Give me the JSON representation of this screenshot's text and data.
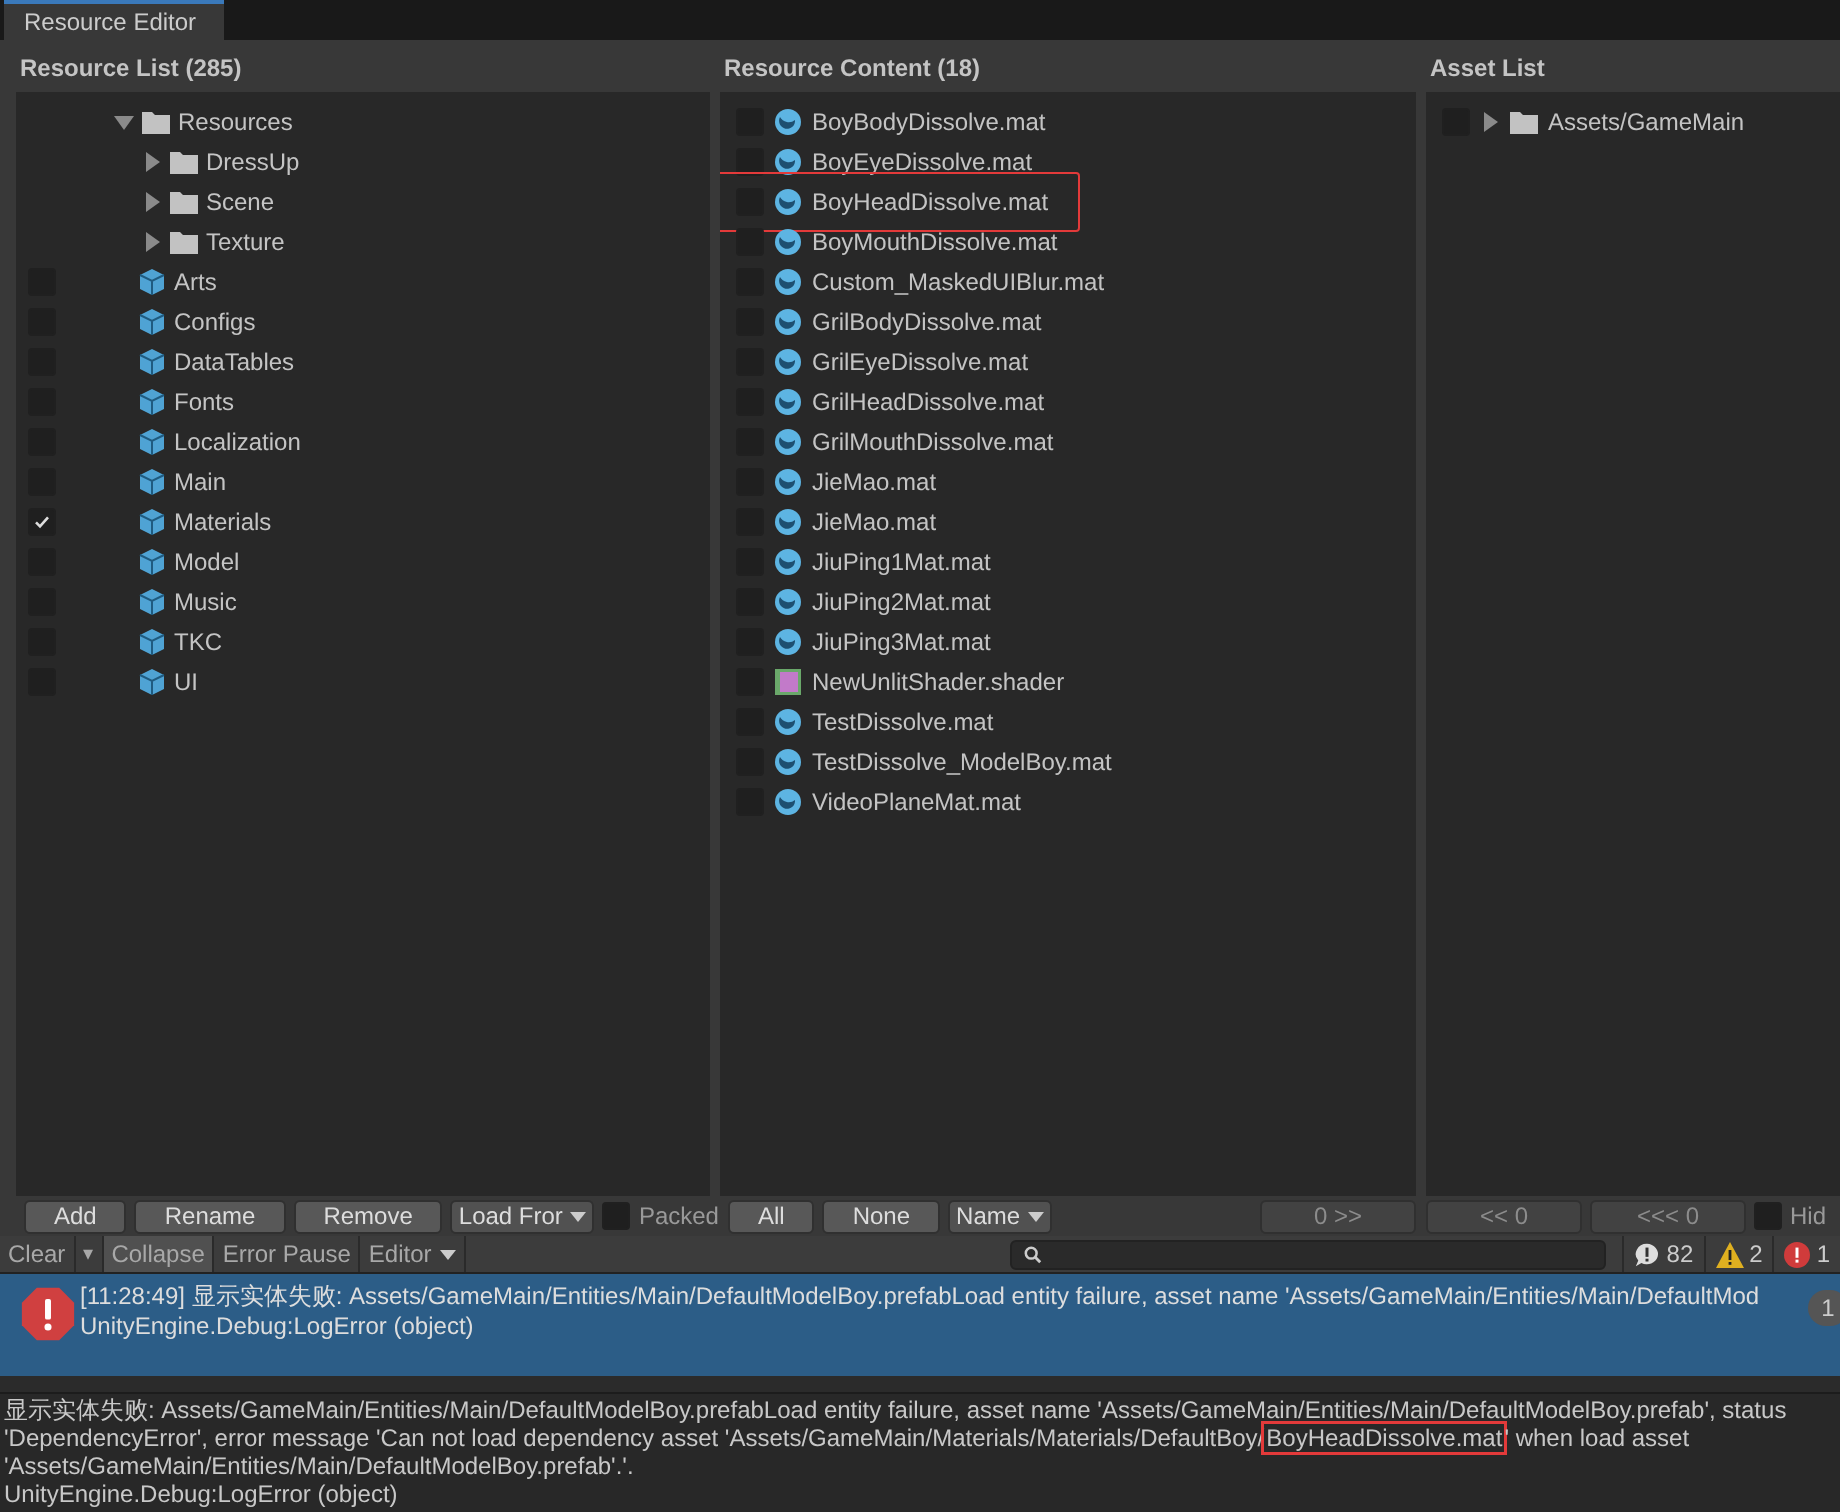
{
  "window": {
    "tab": "Resource Editor"
  },
  "resource_list": {
    "title": "Resource List (285)",
    "tree": [
      {
        "kind": "folder",
        "label": "Resources",
        "expanded": true,
        "children": [
          {
            "kind": "folder",
            "label": "DressUp",
            "expanded": false
          },
          {
            "kind": "folder",
            "label": "Scene",
            "expanded": false
          },
          {
            "kind": "folder",
            "label": "Texture",
            "expanded": false
          },
          {
            "kind": "resource",
            "label": "Arts",
            "checked": false
          },
          {
            "kind": "resource",
            "label": "Configs",
            "checked": false
          },
          {
            "kind": "resource",
            "label": "DataTables",
            "checked": false
          },
          {
            "kind": "resource",
            "label": "Fonts",
            "checked": false
          },
          {
            "kind": "resource",
            "label": "Localization",
            "checked": false
          },
          {
            "kind": "resource",
            "label": "Main",
            "checked": false
          },
          {
            "kind": "resource",
            "label": "Materials",
            "checked": true
          },
          {
            "kind": "resource",
            "label": "Model",
            "checked": false
          },
          {
            "kind": "resource",
            "label": "Music",
            "checked": false
          },
          {
            "kind": "resource",
            "label": "TKC",
            "checked": false
          },
          {
            "kind": "resource",
            "label": "UI",
            "checked": false
          }
        ]
      }
    ],
    "buttons": [
      "Add",
      "Rename",
      "Remove"
    ],
    "load_dropdown": "Load Fror",
    "packed": {
      "label": "Packed",
      "checked": false
    }
  },
  "resource_content": {
    "title": "Resource Content (18)",
    "items": [
      {
        "kind": "material",
        "label": "BoyBodyDissolve.mat",
        "checked": false
      },
      {
        "kind": "material",
        "label": "BoyEyeDissolve.mat",
        "checked": false
      },
      {
        "kind": "material",
        "label": "BoyHeadDissolve.mat",
        "checked": false,
        "highlighted": true
      },
      {
        "kind": "material",
        "label": "BoyMouthDissolve.mat",
        "checked": false
      },
      {
        "kind": "material",
        "label": "Custom_MaskedUIBlur.mat",
        "checked": false
      },
      {
        "kind": "material",
        "label": "GrilBodyDissolve.mat",
        "checked": false
      },
      {
        "kind": "material",
        "label": "GrilEyeDissolve.mat",
        "checked": false
      },
      {
        "kind": "material",
        "label": "GrilHeadDissolve.mat",
        "checked": false
      },
      {
        "kind": "material",
        "label": "GrilMouthDissolve.mat",
        "checked": false
      },
      {
        "kind": "material",
        "label": "JieMao.mat",
        "checked": false
      },
      {
        "kind": "material",
        "label": "JieMao.mat",
        "checked": false
      },
      {
        "kind": "material",
        "label": "JiuPing1Mat.mat",
        "checked": false
      },
      {
        "kind": "material",
        "label": "JiuPing2Mat.mat",
        "checked": false
      },
      {
        "kind": "material",
        "label": "JiuPing3Mat.mat",
        "checked": false
      },
      {
        "kind": "shader",
        "label": "NewUnlitShader.shader",
        "checked": false
      },
      {
        "kind": "material",
        "label": "TestDissolve.mat",
        "checked": false
      },
      {
        "kind": "material",
        "label": "TestDissolve_ModelBoy.mat",
        "checked": false
      },
      {
        "kind": "material",
        "label": "VideoPlaneMat.mat",
        "checked": false
      }
    ],
    "buttons": [
      "All",
      "None"
    ],
    "sort_dropdown": "Name",
    "add_button": "0 >>"
  },
  "asset_list": {
    "title": "Asset List",
    "items": [
      {
        "label": "Assets/GameMain",
        "checked": false,
        "expanded": false
      }
    ],
    "buttons": [
      "<< 0",
      "<<< 0"
    ],
    "hide": {
      "label": "Hid",
      "checked": false
    }
  },
  "console": {
    "toolbar": [
      {
        "kind": "button",
        "label": "Clear",
        "on": false
      },
      {
        "kind": "caret",
        "label": "▾",
        "on": false
      },
      {
        "kind": "button",
        "label": "Collapse",
        "on": true
      },
      {
        "kind": "button",
        "label": "Error Pause",
        "on": false
      },
      {
        "kind": "dropdown",
        "label": "Editor",
        "on": false
      }
    ],
    "counts": [
      {
        "kind": "info",
        "count": "82"
      },
      {
        "kind": "warning",
        "count": "2"
      },
      {
        "kind": "error",
        "count": "1"
      }
    ],
    "entries": [
      {
        "kind": "error",
        "selected": true,
        "lines": [
          "[11:28:49] 显示实体失败: Assets/GameMain/Entities/Main/DefaultModelBoy.prefabLoad entity failure, asset name 'Assets/GameMain/Entities/Main/DefaultMod",
          "UnityEngine.Debug:LogError (object)"
        ],
        "badge": "1"
      }
    ],
    "detail": {
      "message_parts": [
        {
          "text": "显示实体失败: Assets/GameMain/Entities/Main/DefaultModelBoy.prefabLoad entity failure, asset name 'Assets/GameMain/Entities/Main/DefaultModelBoy.prefab', status 'DependencyError', error message 'Can not load dependency asset 'Assets/GameMain/Materials/Materials/DefaultBoy/",
          "highlighted": false
        },
        {
          "text": "BoyHeadDissolve.mat",
          "highlighted": true
        },
        {
          "text": "' when load asset 'Assets/GameMain/Entities/Main/DefaultModelBoy.prefab'.'.",
          "highlighted": false
        }
      ],
      "trace": "UnityEngine.Debug:LogError (object)"
    }
  }
}
